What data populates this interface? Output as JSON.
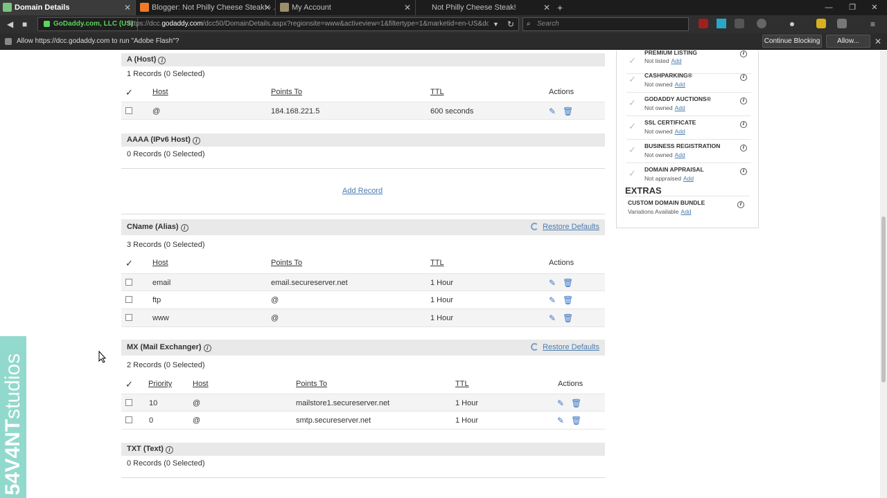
{
  "browser": {
    "tabs": [
      {
        "title": "Domain Details",
        "active": true
      },
      {
        "title": "Blogger: Not Philly Cheese Steak! - ...",
        "active": false
      },
      {
        "title": "My Account",
        "active": false
      },
      {
        "title": "Not Philly Cheese Steak!",
        "active": false
      }
    ],
    "site_identity": "GoDaddy.com, LLC (US)",
    "url_prefix": "https://dcc.",
    "url_domain": "godaddy.com",
    "url_rest": "/dcc50/DomainDetails.aspx?regionsite=www&activeview=1&filtertype=1&marketid=en-US&dom",
    "search_placeholder": "Search",
    "notification": {
      "text": "Allow https://dcc.godaddy.com to run \"Adobe Flash\"?",
      "continue_blocking": "Continue Blocking",
      "allow": "Allow..."
    }
  },
  "dns": {
    "a": {
      "title": "A (Host)",
      "count": "1 Records (0 Selected)",
      "headers": {
        "host": "Host",
        "points_to": "Points To",
        "ttl": "TTL",
        "actions": "Actions"
      },
      "rows": [
        {
          "host": "@",
          "points_to": "184.168.221.5",
          "ttl": "600 seconds"
        }
      ]
    },
    "aaaa": {
      "title": "AAAA (IPv6 Host)",
      "count": "0 Records (0 Selected)",
      "add_record": "Add Record"
    },
    "cname": {
      "title": "CName (Alias)",
      "restore": "Restore Defaults",
      "count": "3 Records (0 Selected)",
      "headers": {
        "host": "Host",
        "points_to": "Points To",
        "ttl": "TTL",
        "actions": "Actions"
      },
      "rows": [
        {
          "host": "email",
          "points_to": "email.secureserver.net",
          "ttl": "1 Hour"
        },
        {
          "host": "ftp",
          "points_to": "@",
          "ttl": "1 Hour"
        },
        {
          "host": "www",
          "points_to": "@",
          "ttl": "1 Hour"
        }
      ]
    },
    "mx": {
      "title": "MX (Mail Exchanger)",
      "restore": "Restore Defaults",
      "count": "2 Records (0 Selected)",
      "headers": {
        "priority": "Priority",
        "host": "Host",
        "points_to": "Points To",
        "ttl": "TTL",
        "actions": "Actions"
      },
      "rows": [
        {
          "priority": "10",
          "host": "@",
          "points_to": "mailstore1.secureserver.net",
          "ttl": "1 Hour"
        },
        {
          "priority": "0",
          "host": "@",
          "points_to": "smtp.secureserver.net",
          "ttl": "1 Hour"
        }
      ]
    },
    "txt": {
      "title": "TXT (Text)",
      "count": "0 Records (0 Selected)"
    }
  },
  "sidebar": {
    "items": [
      {
        "name": "PREMIUM LISTING",
        "status": "Not listed",
        "link": "Add"
      },
      {
        "name": "CASHPARKING®",
        "status": "Not owned",
        "link": "Add"
      },
      {
        "name": "GODADDY AUCTIONS®",
        "status": "Not owned",
        "link": "Add"
      },
      {
        "name": "SSL CERTIFICATE",
        "status": "Not owned",
        "link": "Add"
      },
      {
        "name": "BUSINESS REGISTRATION",
        "status": "Not owned",
        "link": "Add"
      },
      {
        "name": "DOMAIN APPRAISAL",
        "status": "Not appraised",
        "link": "Add"
      }
    ],
    "extras_title": "EXTRAS",
    "extras": [
      {
        "name": "CUSTOM DOMAIN BUNDLE",
        "status": "Variations Available",
        "link": "Add"
      }
    ]
  },
  "watermark": {
    "bold": "54V4NT",
    "thin": "studios"
  }
}
